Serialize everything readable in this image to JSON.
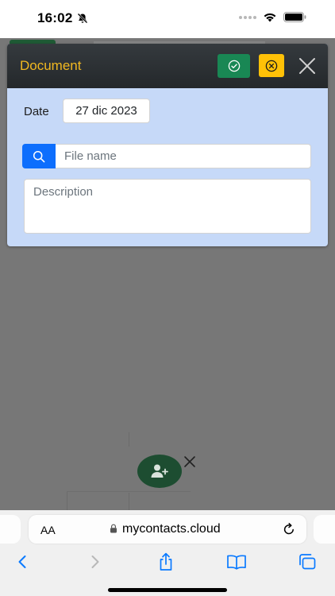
{
  "status_bar": {
    "time": "16:02",
    "icons": [
      "bell-slash-icon",
      "signal-dots-icon",
      "wifi-icon",
      "battery-icon"
    ]
  },
  "modal": {
    "title": "Document",
    "confirm_icon": "check-circle-icon",
    "cancel_icon": "x-circle-icon",
    "close_icon": "close-icon",
    "date_label": "Date",
    "date_value": "27 dic 2023",
    "search_icon": "search-icon",
    "file_name_placeholder": "File name",
    "file_name_value": "",
    "description_placeholder": "Description",
    "description_value": "",
    "colors": {
      "title": "#f1b820",
      "confirm": "#198754",
      "cancel": "#ffc107",
      "search": "#0d6efd",
      "body": "#c6d9f8"
    }
  },
  "background": {
    "fab_icon": "add-user-icon",
    "fab_close_icon": "close-icon",
    "fab_color": "#1d4d31"
  },
  "browser": {
    "text_size_label": "AA",
    "url": "mycontacts.cloud",
    "lock_icon": "lock-icon",
    "reload_icon": "reload-icon",
    "toolbar_icons": [
      "back-icon",
      "forward-icon",
      "share-icon",
      "bookmarks-icon",
      "tabs-icon"
    ]
  }
}
